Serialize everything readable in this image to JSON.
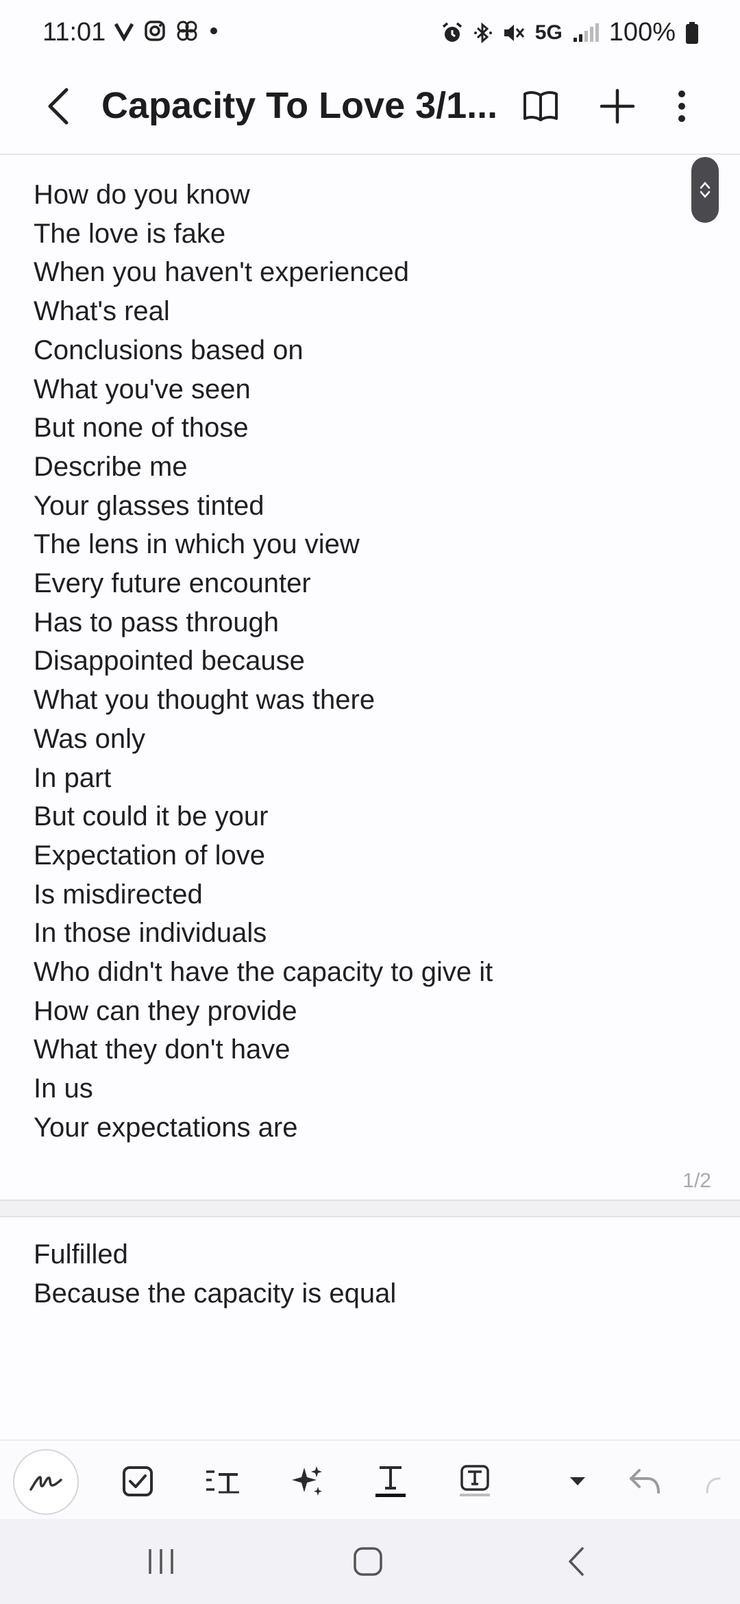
{
  "status_bar": {
    "time": "11:01",
    "network": "5G",
    "battery": "100%"
  },
  "header": {
    "title": "Capacity To Love 3/1..."
  },
  "note": {
    "page1_lines": [
      "How do you know",
      "The love is fake",
      "When you haven't experienced",
      "What's real",
      "Conclusions based on",
      "What you've seen",
      "But none of those",
      "Describe me",
      "Your glasses tinted",
      "The lens in which you view",
      "Every future encounter",
      "Has to pass through",
      "Disappointed because",
      "What you thought was there",
      "Was only",
      "In part",
      "But could it be your",
      "Expectation of love",
      "Is misdirected",
      "In those individuals",
      "Who didn't have the capacity to give it",
      "How can they provide",
      "What they don't have",
      "In us",
      "Your expectations are"
    ],
    "page1_number": "1/2",
    "page2_lines": [
      "Fulfilled",
      "Because the capacity is equal"
    ]
  },
  "colors": {
    "text": "#1f1f22",
    "icon": "#2b2b2e",
    "background": "#fdfcfe",
    "scroll_pill": "#4a4a4e"
  }
}
